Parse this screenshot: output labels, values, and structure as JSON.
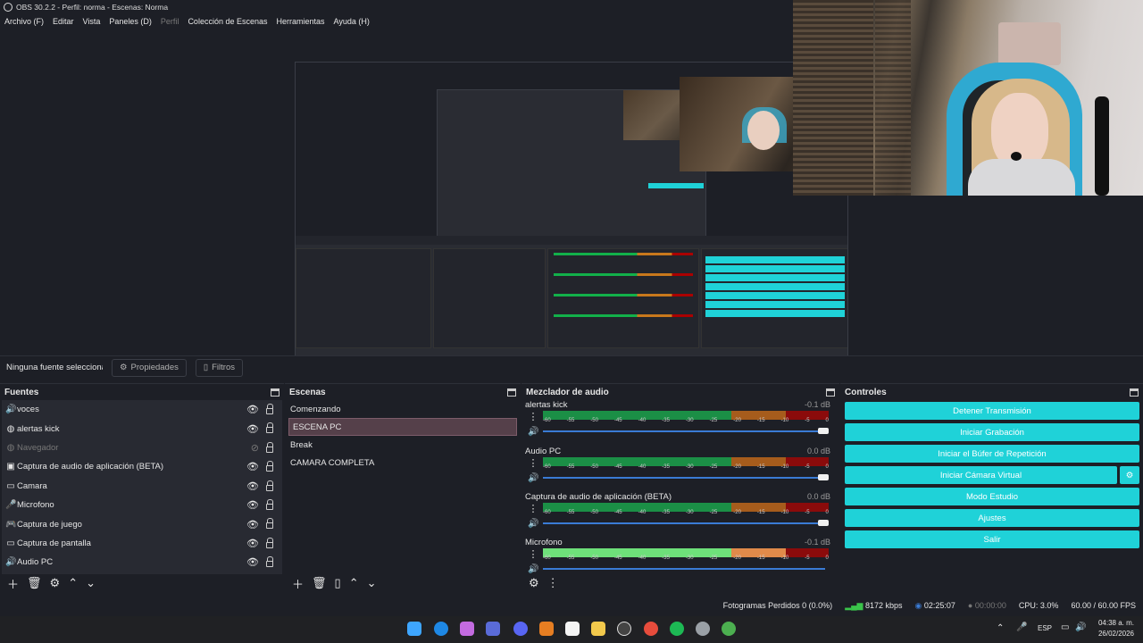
{
  "window": {
    "title": "OBS 30.2.2 - Perfil: norma - Escenas: Norma"
  },
  "menu": [
    "Archivo (F)",
    "Editar",
    "Vista",
    "Paneles (D)",
    "Perfil",
    "Colección de Escenas",
    "Herramientas",
    "Ayuda (H)"
  ],
  "source_bar": {
    "label": "Ninguna fuente seleccionad",
    "properties": "Propiedades",
    "filters": "Filtros"
  },
  "docks": {
    "sources": {
      "title": "Fuentes",
      "items": [
        {
          "label": "voces",
          "icon": "speaker-icon",
          "visible": true
        },
        {
          "label": "alertas kick",
          "icon": "globe-icon",
          "visible": true
        },
        {
          "label": "Navegador",
          "icon": "globe-icon",
          "visible": false
        },
        {
          "label": "Captura de audio de aplicación (BETA)",
          "icon": "app-audio-icon",
          "visible": true
        },
        {
          "label": "Camara",
          "icon": "camera-icon",
          "visible": true
        },
        {
          "label": "Microfono",
          "icon": "microphone-icon",
          "visible": true
        },
        {
          "label": "Captura de juego",
          "icon": "gamepad-icon",
          "visible": true
        },
        {
          "label": "Captura de pantalla",
          "icon": "monitor-icon",
          "visible": true
        },
        {
          "label": "Audio PC",
          "icon": "speaker-icon",
          "visible": true
        }
      ]
    },
    "scenes": {
      "title": "Escenas",
      "items": [
        "Comenzando",
        "ESCENA PC",
        "Break",
        "CAMARA COMPLETA"
      ],
      "selected": "ESCENA PC"
    },
    "mixer": {
      "title": "Mezclador de audio",
      "scale": [
        "-60",
        "-55",
        "-50",
        "-45",
        "-40",
        "-35",
        "-30",
        "-25",
        "-20",
        "-15",
        "-10",
        "-5",
        "0"
      ],
      "channels": [
        {
          "name": "alertas kick",
          "db": "-0.1 dB"
        },
        {
          "name": "Audio PC",
          "db": "0.0 dB"
        },
        {
          "name": "Captura de audio de aplicación (BETA)",
          "db": "0.0 dB"
        },
        {
          "name": "Microfono",
          "db": "-0.1 dB"
        }
      ]
    },
    "controls": {
      "title": "Controles",
      "buttons": [
        "Detener Transmisión",
        "Iniciar Grabación",
        "Iniciar el Búfer de Repetición",
        "Iniciar Cámara Virtual",
        "Modo Estudio",
        "Ajustes",
        "Salir"
      ]
    }
  },
  "status": {
    "dropped": "Fotogramas Perdidos 0 (0.0%)",
    "bitrate": "8172 kbps",
    "stream_time": "02:25:07",
    "rec_time": "00:00:00",
    "cpu": "CPU: 3.0%",
    "fps": "60.00 / 60.00 FPS"
  },
  "taskbar": {
    "lang": "ESP",
    "time": "04:38 a. m.",
    "date": "26/02/2026"
  },
  "colors": {
    "accent": "#1fd2d8",
    "background": "#1d1f26",
    "scene_selected": "#55404a"
  }
}
